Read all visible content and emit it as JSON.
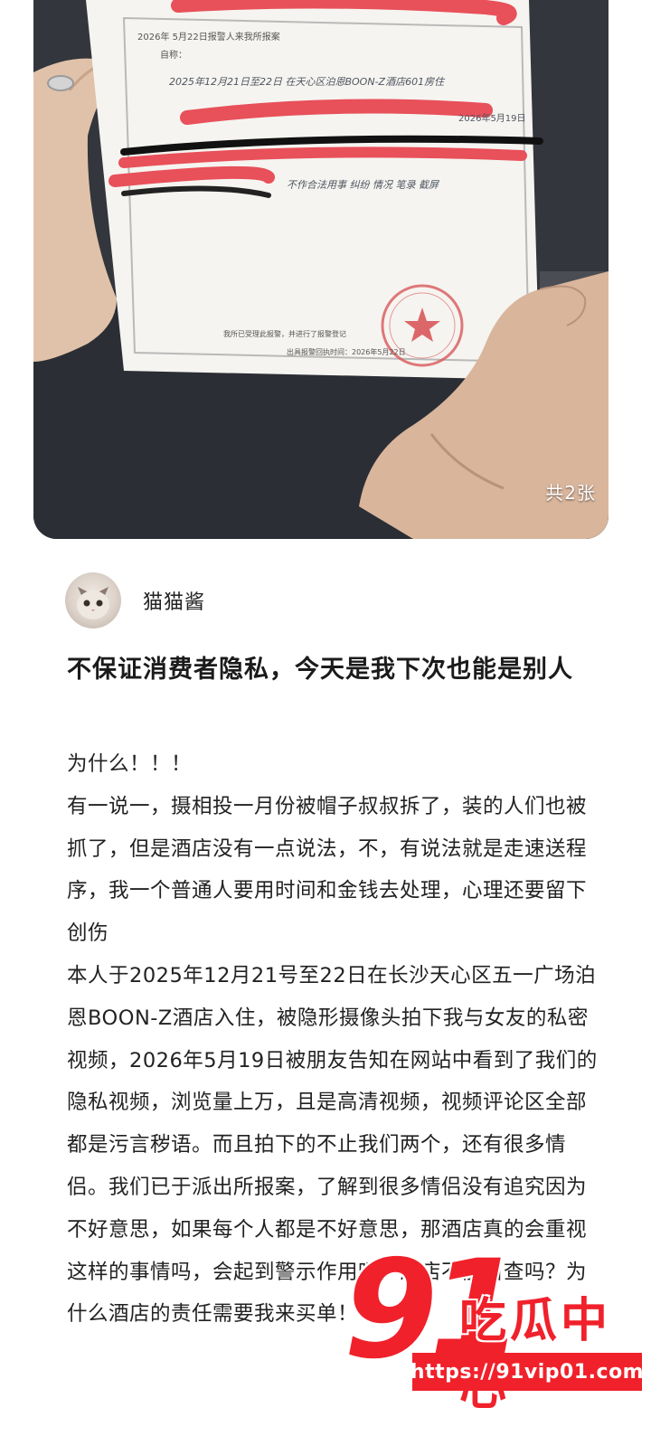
{
  "post": {
    "image_count_badge": "共2张",
    "author": {
      "name": "猫猫酱"
    },
    "title": "不保证消费者隐私，今天是我下次也能是别人",
    "paragraphs": [
      "为什么！！！",
      "有一说一，摄相投一月份被帽子叔叔拆了，装的人们也被抓了，但是酒店没有一点说法，不，有说法就是走速送程序，我一个普通人要用时间和金钱去处理，心理还要留下创伤",
      "本人于2025年12月21号至22日在长沙天心区五一广场泊恩BOON-Z酒店入住，被隐形摄像头拍下我与女友的私密视频，2026年5月19日被朋友告知在网站中看到了我们的隐私视频，浏览量上万，且是高清视频，视频评论区全部都是污言秽语。而且拍下的不止我们两个，还有很多情侣。我们已于派出所报案，了解到很多情侣没有追究因为不好意思，如果每个人都是不好意思，那酒店真的会重视这样的事情吗，会起到警示作用吗！酒店不能自查吗？为什么酒店的责任需要我来买单！"
    ]
  },
  "document_photo": {
    "line1": "2026年 5月22日报警人来我所报案",
    "line2": "自称：",
    "line3": "2025年12月21日至22日 在天心区泊恩BOON-Z酒店601房住",
    "line4": "2026年5月19日",
    "line5": "不作合法用事 纠纷 情况 笔录 截屏",
    "footer1": "我所已受理此报警，并进行了报警登记",
    "footer2": "出具报警回执时间：2026年5月22日"
  },
  "watermark": {
    "number": "91",
    "text": "吃瓜中心",
    "url": "https://91vip01.com"
  },
  "colors": {
    "accent": "#f0212b",
    "text": "#222222"
  }
}
